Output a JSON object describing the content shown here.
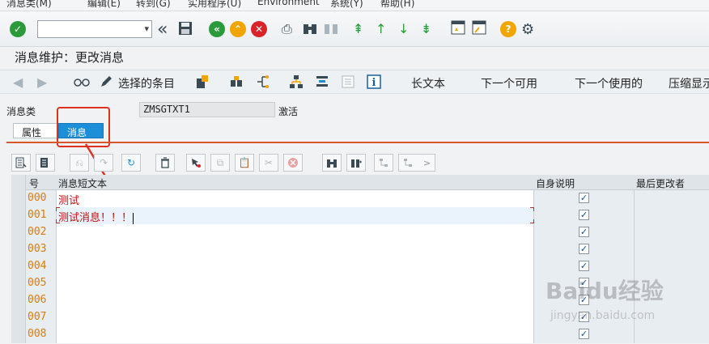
{
  "menu": [
    "消息类(M)",
    "编辑(E)",
    "转到(G)",
    "实用程序(U)",
    "Environment",
    "系统(Y)",
    "帮助(H)"
  ],
  "command_field": {
    "value": ""
  },
  "screen_title": "消息维护：更改消息",
  "app_toolbar": {
    "selected_entries": "选择的条目",
    "long_text": "长文本",
    "next_available": "下一个可用",
    "next_used": "下一个使用的",
    "compress_display": "压缩显示"
  },
  "header": {
    "message_class_label": "消息类",
    "message_class_value": "ZMSGTXT1",
    "status": "激活"
  },
  "tabs": [
    {
      "label": "属性",
      "active": false
    },
    {
      "label": "消息",
      "active": true
    }
  ],
  "table": {
    "columns": {
      "number": "号",
      "short_text": "消息短文本",
      "self_explanatory": "自身说明",
      "last_changed_by": "最后更改者"
    },
    "rows": [
      {
        "no": "000",
        "text": "测试",
        "checked": true
      },
      {
        "no": "001",
        "text": "测试消息！！！",
        "checked": true
      },
      {
        "no": "002",
        "text": "",
        "checked": true
      },
      {
        "no": "003",
        "text": "",
        "checked": true
      },
      {
        "no": "004",
        "text": "",
        "checked": true
      },
      {
        "no": "005",
        "text": "",
        "checked": true
      },
      {
        "no": "006",
        "text": "",
        "checked": true
      },
      {
        "no": "007",
        "text": "",
        "checked": true
      },
      {
        "no": "008",
        "text": "",
        "checked": true
      }
    ]
  },
  "watermark": {
    "main": "Baidu经验",
    "sub": "jingyan.baidu.com"
  },
  "colors": {
    "accent": "#1c8fd8",
    "annotation_red": "#e0311f",
    "message_text": "#c01010",
    "row_number": "#e07b00"
  }
}
